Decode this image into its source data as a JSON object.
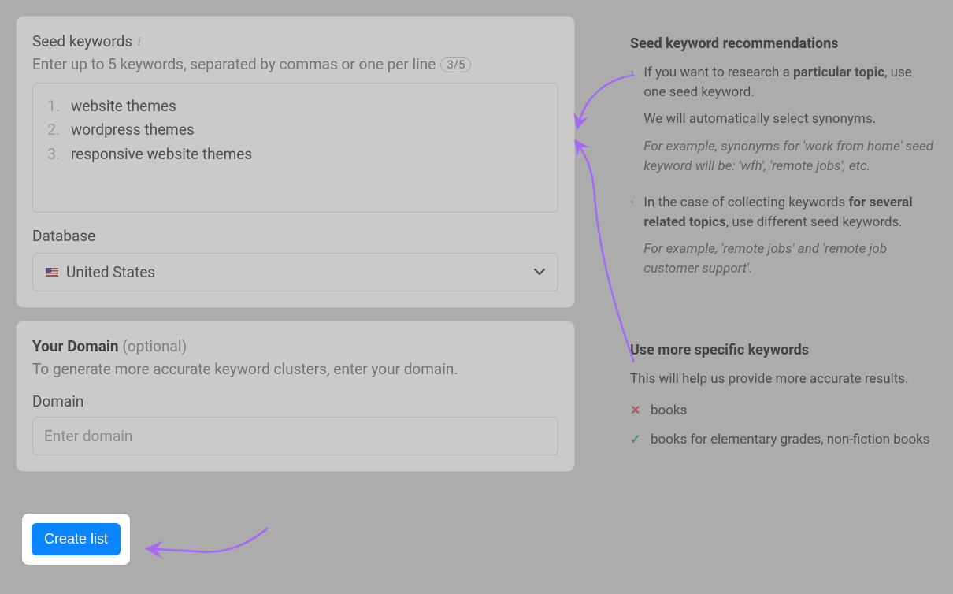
{
  "seed": {
    "title": "Seed keywords",
    "subtitle": "Enter up to 5 keywords, separated by commas or one per line",
    "count": "3/5",
    "keywords": [
      "website themes",
      "wordpress themes",
      "responsive website themes"
    ]
  },
  "database": {
    "label": "Database",
    "selected": "United States"
  },
  "domain": {
    "title_bold": "Your Domain",
    "title_light": "(optional)",
    "description": "To generate more accurate keyword clusters, enter your domain.",
    "label": "Domain",
    "placeholder": "Enter domain"
  },
  "button": {
    "create": "Create list"
  },
  "recs": {
    "heading": "Seed keyword recommendations",
    "bullet1_a": "If you want to research a ",
    "bullet1_b": "particular topic",
    "bullet1_c": ", use one seed keyword.",
    "bullet1_line2": "We will automatically select synonyms.",
    "bullet1_ex": "For example, synonyms for 'work from home' seed keyword will be: 'wfh', 'remote jobs', etc.",
    "bullet2_a": "In the case of collecting keywords ",
    "bullet2_b": "for several related topics",
    "bullet2_c": ", use different seed keywords.",
    "bullet2_ex": "For example, 'remote jobs' and 'remote job customer support'.",
    "heading2": "Use more specific keywords",
    "desc2": "This will help us provide more accurate results.",
    "bad": "books",
    "good": "books for elementary grades, non-fiction books"
  }
}
